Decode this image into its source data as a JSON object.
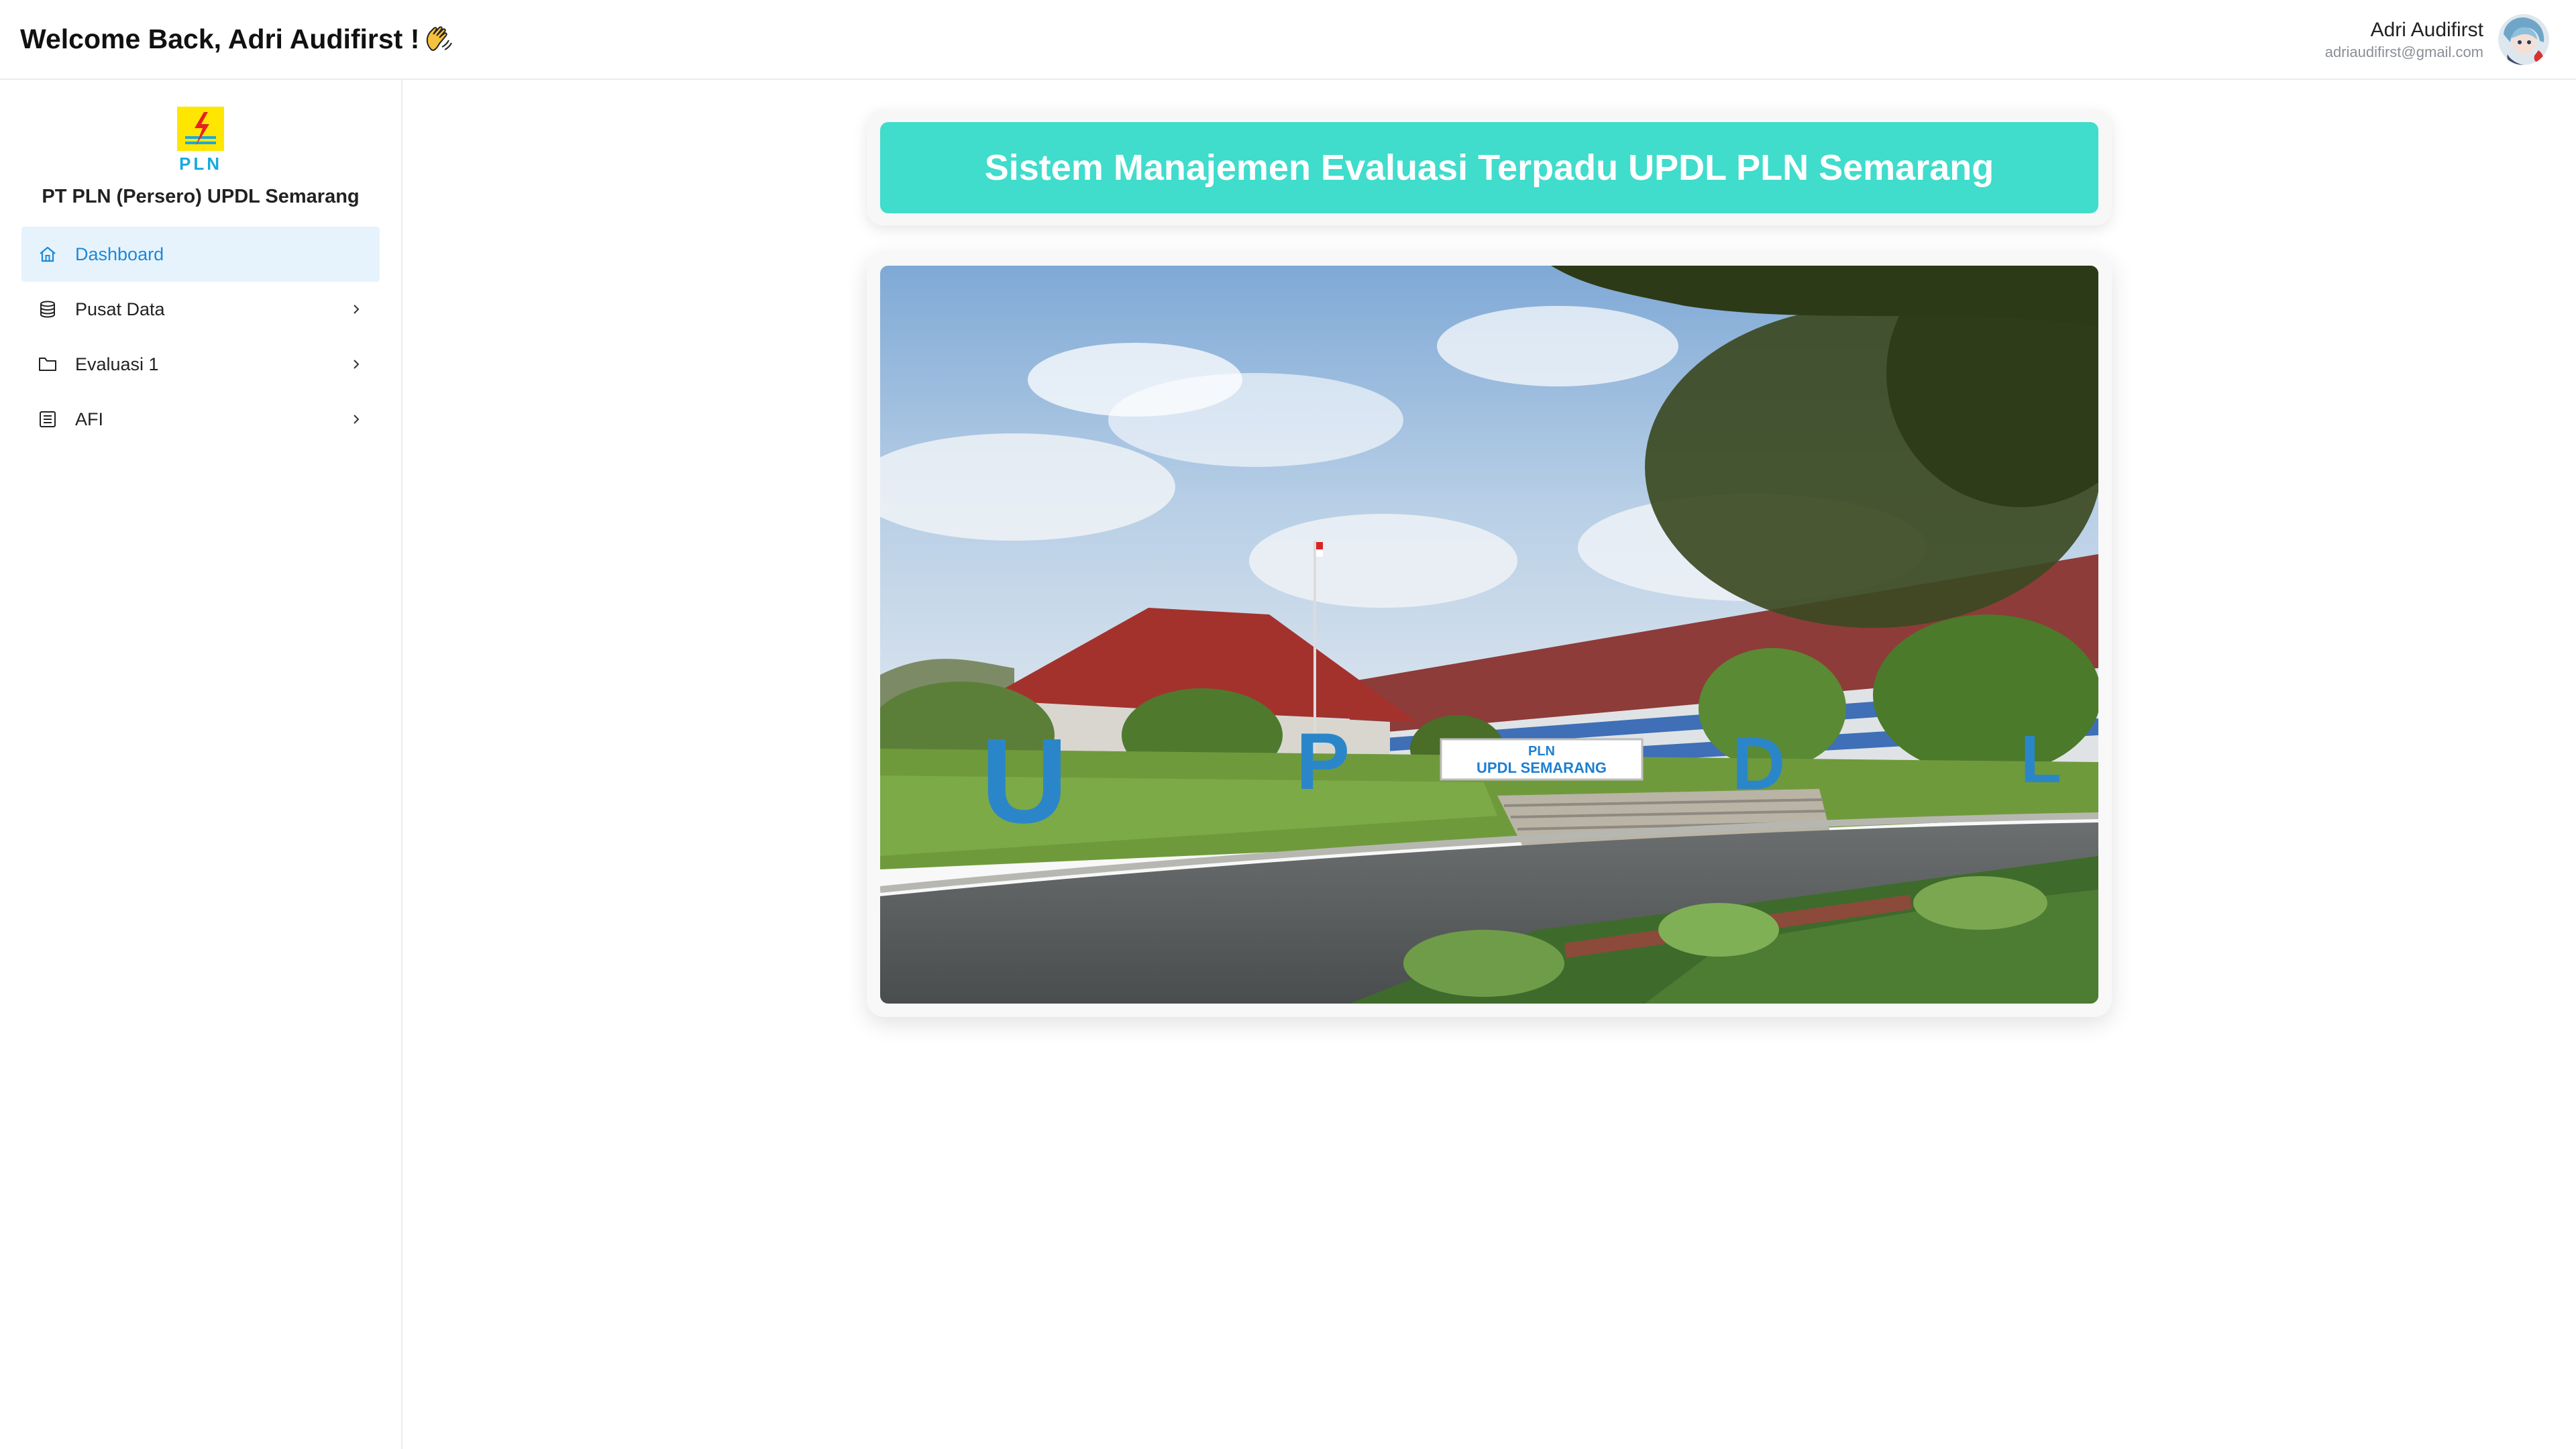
{
  "header": {
    "welcome": "Welcome Back, Adri Audifirst !",
    "user_name": "Adri Audifirst",
    "user_email": "adriaudifirst@gmail.com"
  },
  "sidebar": {
    "logo_text": "PLN",
    "company": "PT PLN (Persero) UPDL Semarang",
    "items": [
      {
        "label": "Dashboard",
        "icon": "home-icon",
        "active": true
      },
      {
        "label": "Pusat Data",
        "icon": "database-icon",
        "has_children": true
      },
      {
        "label": "Evaluasi 1",
        "icon": "folder-icon",
        "has_children": true
      },
      {
        "label": "AFI",
        "icon": "list-icon",
        "has_children": true
      }
    ]
  },
  "main": {
    "title": "Sistem Manajemen Evaluasi Terpadu UPDL PLN Semarang",
    "photo": {
      "sign_brand": "PLN",
      "sign_text": "UPDL SEMARANG",
      "letters": [
        "U",
        "P",
        "D",
        "L"
      ]
    }
  },
  "colors": {
    "accent": "#40dccc",
    "active_bg": "#e6f3fd",
    "active_text": "#1e88d9"
  }
}
